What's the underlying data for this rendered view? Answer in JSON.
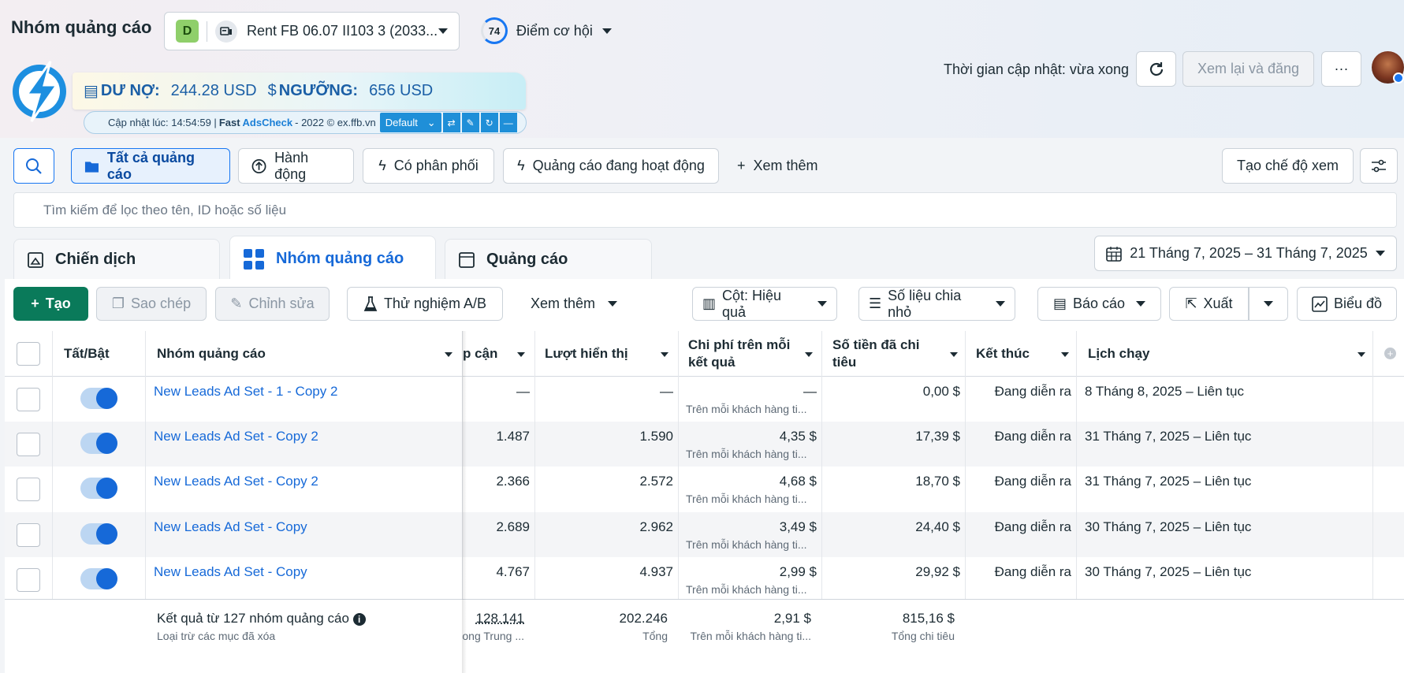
{
  "header": {
    "title": "Nhóm quảng cáo",
    "account": {
      "badge": "D",
      "name": "Rent FB 06.07 II103 3 (2033..."
    },
    "opportunity": {
      "score": "74",
      "label": "Điểm cơ hội"
    },
    "update_time": "Thời gian cập nhật: vừa xong",
    "review_label": "Xem lại và đăng",
    "more_label": "···"
  },
  "extension": {
    "debt_label": "DƯ NỢ:",
    "debt_value": "244.28 USD",
    "threshold_label": "NGƯỠNG:",
    "threshold_value": "656 USD",
    "status_prefix": "Cập nhật lúc: 14:54:59 |",
    "status_fast": "Fast",
    "status_brand": "AdsCheck",
    "status_suffix": "- 2022 © ex.ffb.vn",
    "dropdown": "Default"
  },
  "filters": {
    "all_ads": "Tất cả quảng cáo",
    "action": "Hành động",
    "delivering": "Có phân phối",
    "running": "Quảng cáo đang hoạt động",
    "more": "Xem thêm",
    "create_view": "Tạo chế độ xem",
    "search_placeholder": "Tìm kiếm để lọc theo tên, ID hoặc số liệu"
  },
  "tabs": {
    "campaigns": "Chiến dịch",
    "adsets": "Nhóm quảng cáo",
    "ads": "Quảng cáo",
    "date_range": "21 Tháng 7, 2025 – 31 Tháng 7, 2025"
  },
  "toolbar": {
    "create": "Tạo",
    "copy": "Sao chép",
    "edit": "Chỉnh sửa",
    "ab_test": "Thử nghiệm A/B",
    "more": "Xem thêm",
    "columns": "Cột: Hiệu quả",
    "breakdown": "Số liệu chia nhỏ",
    "reports": "Báo cáo",
    "export": "Xuất",
    "chart": "Biểu đồ"
  },
  "table": {
    "headers": {
      "toggle": "Tất/Bật",
      "name": "Nhóm quảng cáo",
      "reach": "p cận",
      "impressions": "Lượt hiển thị",
      "cpr_line1": "Chi phí trên mỗi",
      "cpr_line2": "kết quả",
      "spent_line1": "Số tiền đã chi",
      "spent_line2": "tiêu",
      "ends": "Kết thúc",
      "schedule": "Lịch chạy"
    },
    "rows": [
      {
        "name": "New Leads Ad Set - 1 - Copy 2",
        "reach": "—",
        "impressions": "—",
        "cpr": "—",
        "cpr_sub": "Trên mỗi khách hàng ti...",
        "spent": "0,00 $",
        "ends": "Đang diễn ra",
        "schedule": "8 Tháng 8, 2025 – Liên tục"
      },
      {
        "name": "New Leads Ad Set - Copy 2",
        "reach": "1.487",
        "impressions": "1.590",
        "cpr": "4,35 $",
        "cpr_sub": "Trên mỗi khách hàng ti...",
        "spent": "17,39 $",
        "ends": "Đang diễn ra",
        "schedule": "31 Tháng 7, 2025 – Liên tục"
      },
      {
        "name": "New Leads Ad Set - Copy 2",
        "reach": "2.366",
        "impressions": "2.572",
        "cpr": "4,68 $",
        "cpr_sub": "Trên mỗi khách hàng ti...",
        "spent": "18,70 $",
        "ends": "Đang diễn ra",
        "schedule": "31 Tháng 7, 2025 – Liên tục"
      },
      {
        "name": "New Leads Ad Set - Copy",
        "reach": "2.689",
        "impressions": "2.962",
        "cpr": "3,49 $",
        "cpr_sub": "Trên mỗi khách hàng ti...",
        "spent": "24,40 $",
        "ends": "Đang diễn ra",
        "schedule": "30 Tháng 7, 2025 – Liên tục"
      },
      {
        "name": "New Leads Ad Set - Copy",
        "reach": "4.767",
        "impressions": "4.937",
        "cpr": "2,99 $",
        "cpr_sub": "Trên mỗi khách hàng ti...",
        "spent": "29,92 $",
        "ends": "Đang diễn ra",
        "schedule": "30 Tháng 7, 2025 – Liên tục"
      }
    ],
    "summary": {
      "title": "Kết quả từ 127 nhóm quảng cáo",
      "subtitle": "Loại trừ các mục đã xóa",
      "reach": "128.141",
      "reach_sub": "ong Trung ...",
      "impressions": "202.246",
      "impressions_sub": "Tổng",
      "cpr": "2,91 $",
      "cpr_sub": "Trên mỗi khách hàng ti...",
      "spent": "815,16 $",
      "spent_sub": "Tổng chi tiêu"
    }
  },
  "colors": {
    "accent": "#1877f2",
    "create": "#0a7a5a",
    "link": "#1669d8"
  }
}
